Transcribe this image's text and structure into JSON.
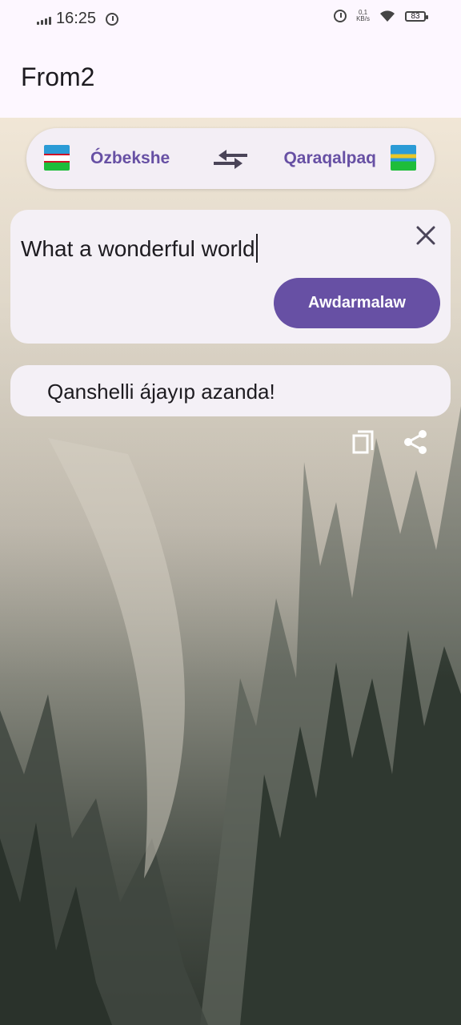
{
  "status_bar": {
    "time": "16:25",
    "net_speed_value": "0,1",
    "net_speed_unit": "KB/s",
    "battery": "83"
  },
  "app_bar": {
    "title": "From2"
  },
  "language_selector": {
    "source_label": "Ózbekshe",
    "target_label": "Qaraqalpaq",
    "source_flag_icon": "uzbekistan-flag-icon",
    "target_flag_icon": "karakalpakstan-flag-icon",
    "swap_icon": "swap-arrows-icon"
  },
  "input": {
    "value": "What a wonderful world",
    "clear_icon": "close-icon",
    "translate_label": "Awdarmalaw"
  },
  "result": {
    "text": "Qanshelli ájayıp azanda!"
  },
  "actions": {
    "copy_icon": "copy-icon",
    "share_icon": "share-icon"
  },
  "colors": {
    "accent": "#6750a4",
    "card": "#f4f0f6",
    "appbar": "#fdf7ff"
  }
}
